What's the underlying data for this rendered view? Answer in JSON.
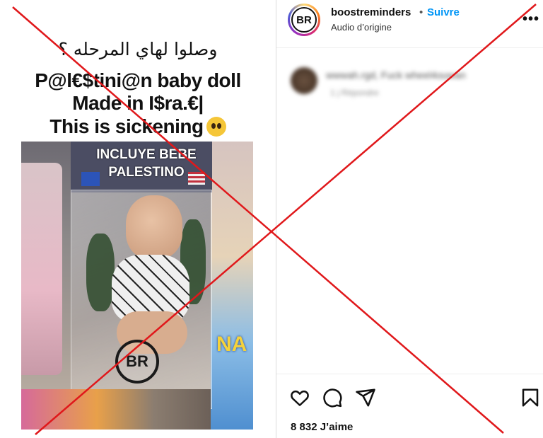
{
  "media": {
    "caption_arabic": "وصلوا لهاي المرحله ؟",
    "caption_line1": "P@l€$tini@n baby doll",
    "caption_line2": "Made in I$ra.€|",
    "caption_line3": "This is sickening",
    "caption_emoji": "pleading-face-icon",
    "box_text_line1": "INCLUYE BEBE",
    "box_text_line2": "PALESTINO",
    "box_side_text": "NA",
    "watermark": "BR"
  },
  "post": {
    "avatar_text": "BR",
    "username": "boostreminders",
    "separator": "•",
    "follow_label": "Suivre",
    "audio_label": "Audio d’origine",
    "more_icon": "more-options-icon",
    "comment_blurred_user": "wwwah.rgd, Fuck wheel4ouwan",
    "comment_blurred_meta": "1 j   Répondre",
    "likes_text": "8 832 J’aime"
  },
  "icons": {
    "like": "heart-icon",
    "comment": "comment-icon",
    "share": "share-icon",
    "save": "bookmark-icon"
  },
  "colors": {
    "follow": "#0095f6",
    "red_x": "#e0181b"
  }
}
